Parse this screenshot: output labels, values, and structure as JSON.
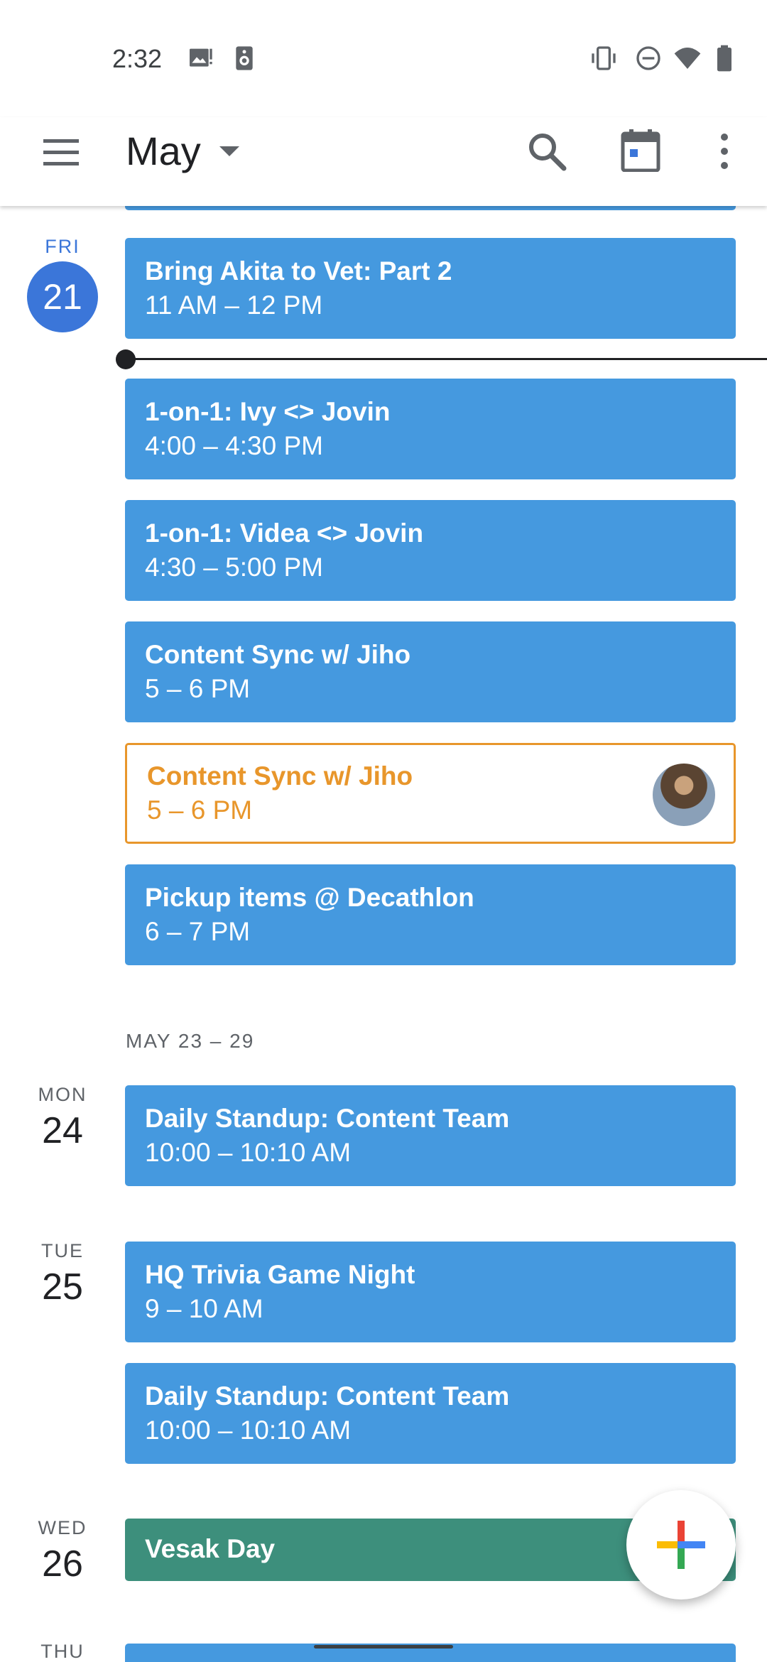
{
  "status_bar": {
    "time": "2:32"
  },
  "app_bar": {
    "month": "May",
    "icons": [
      "menu-icon",
      "search-icon",
      "today-calendar-icon",
      "more-vert-icon"
    ]
  },
  "days": {
    "fri": {
      "label": "FRI",
      "num": "21"
    },
    "mon": {
      "label": "MON",
      "num": "24"
    },
    "tue": {
      "label": "TUE",
      "num": "25"
    },
    "wed": {
      "label": "WED",
      "num": "26"
    },
    "thu": {
      "label": "THU"
    }
  },
  "week_header": "MAY 23 – 29",
  "events": [
    {
      "title": "Bring Akita to Vet: Part 2",
      "time": "11 AM – 12 PM"
    },
    {
      "title": "1-on-1: Ivy <> Jovin",
      "time": "4:00 – 4:30 PM"
    },
    {
      "title": "1-on-1: Videa <> Jovin",
      "time": "4:30 – 5:00 PM"
    },
    {
      "title": "Content Sync w/ Jiho",
      "time": "5 – 6 PM"
    },
    {
      "title": "Content Sync w/ Jiho",
      "time": "5 – 6 PM"
    },
    {
      "title": "Pickup items @ Decathlon",
      "time": "6 – 7 PM"
    },
    {
      "title": "Daily Standup: Content Team",
      "time": "10:00 – 10:10 AM"
    },
    {
      "title": "HQ Trivia Game Night",
      "time": "9 – 10 AM"
    },
    {
      "title": "Daily Standup: Content Team",
      "time": "10:00 – 10:10 AM"
    },
    {
      "title": "Vesak Day"
    }
  ],
  "colors": {
    "event_blue": "#4599df",
    "event_pending_outline": "#e8962b",
    "holiday_green": "#3d8f7c",
    "today_circle": "#3b76d9"
  }
}
